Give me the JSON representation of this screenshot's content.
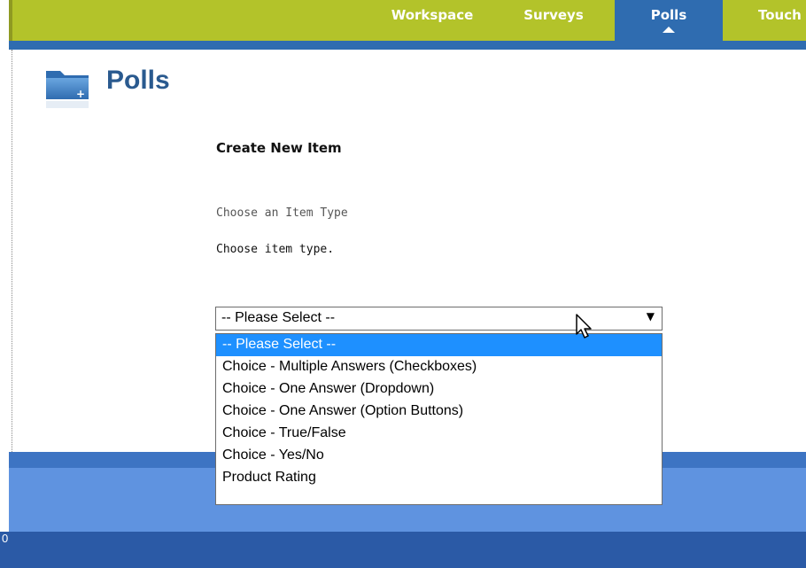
{
  "nav": {
    "tabs": [
      {
        "label": "Workspace"
      },
      {
        "label": "Surveys"
      },
      {
        "label": "Polls",
        "active": true
      },
      {
        "label": "Touch"
      }
    ]
  },
  "page": {
    "title": "Polls",
    "icon": "folder-plus-icon"
  },
  "form": {
    "section_title": "Create New Item",
    "item_type_label": "Choose an Item Type",
    "item_type_help": "Choose item type.",
    "select_value": "-- Please Select --",
    "options": [
      "-- Please Select --",
      "Choice - Multiple Answers (Checkboxes)",
      "Choice - One Answer (Dropdown)",
      "Choice - One Answer (Option Buttons)",
      "Choice - True/False",
      "Choice - Yes/No",
      "Product Rating"
    ],
    "highlighted_index": 0
  },
  "footer": {
    "digit": "0"
  },
  "colors": {
    "nav_green": "#b3c32a",
    "nav_blue": "#2f6cb0",
    "title_blue": "#2a5a8f",
    "highlight": "#1e90ff",
    "footer_light": "#5f93e0",
    "footer_dark": "#2b5aa6"
  }
}
